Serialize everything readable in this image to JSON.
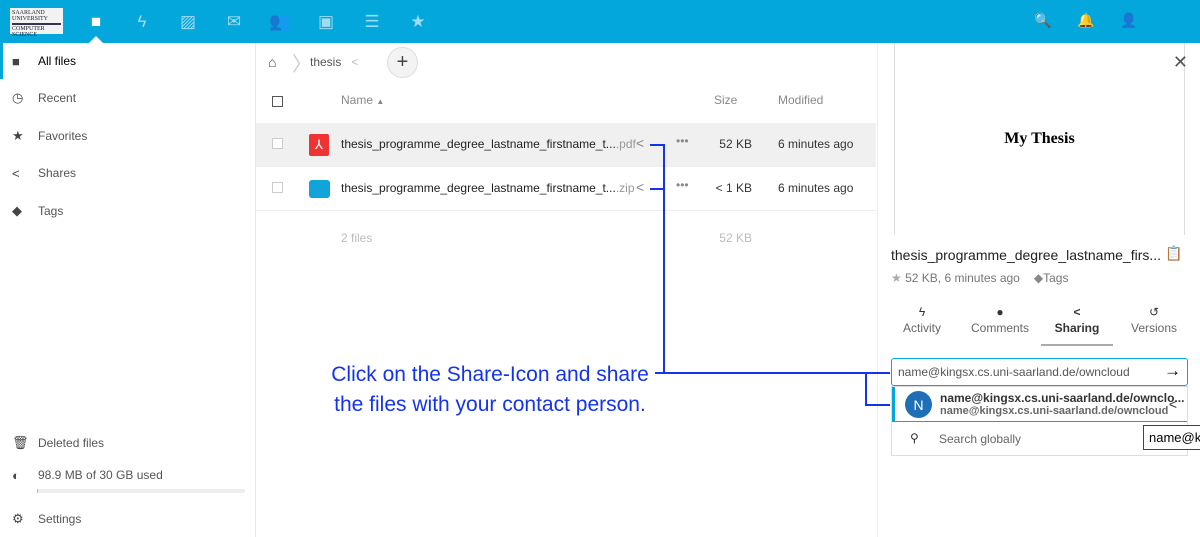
{
  "header": {
    "logo": {
      "line1": "SAARLAND",
      "line2": "UNIVERSITY",
      "line3": "COMPUTER SCIENCE"
    },
    "apps": [
      {
        "icon": "folder-icon",
        "name": "files"
      },
      {
        "icon": "lightning-icon",
        "name": "activity"
      },
      {
        "icon": "image-icon",
        "name": "gallery"
      },
      {
        "icon": "mail-icon",
        "name": "mail"
      },
      {
        "icon": "contacts-icon",
        "name": "contacts"
      },
      {
        "icon": "calendar-icon",
        "name": "calendar"
      },
      {
        "icon": "deck-icon",
        "name": "deck"
      },
      {
        "icon": "star-icon",
        "name": "favorites"
      }
    ],
    "right_icons": [
      "search-icon",
      "bell-icon",
      "user-icon"
    ],
    "accent": "#03a7dc"
  },
  "sidebar": {
    "items": [
      {
        "label": "All files",
        "icon": "folder-icon"
      },
      {
        "label": "Recent",
        "icon": "clock-icon"
      },
      {
        "label": "Favorites",
        "icon": "star-icon"
      },
      {
        "label": "Shares",
        "icon": "share-icon"
      },
      {
        "label": "Tags",
        "icon": "tag-icon"
      }
    ],
    "deleted": "Deleted files",
    "quota": "98.9 MB of 30 GB used",
    "quota_fraction": 0.003,
    "settings": "Settings"
  },
  "breadcrumb": {
    "folder": "thesis"
  },
  "table": {
    "headers": {
      "name": "Name",
      "size": "Size",
      "modified": "Modified"
    },
    "rows": [
      {
        "name": "thesis_programme_degree_lastname_firstname_t...",
        "ext": ".pdf",
        "size": "52 KB",
        "modified": "6 minutes ago",
        "type": "pdf"
      },
      {
        "name": "thesis_programme_degree_lastname_firstname_t...",
        "ext": ".zip",
        "size": "< 1 KB",
        "modified": "6 minutes ago",
        "type": "zip"
      }
    ],
    "summary": {
      "count": "2 files",
      "size": "52 KB"
    }
  },
  "details": {
    "preview_title": "My Thesis",
    "filename": "thesis_programme_degree_lastname_firs...",
    "meta": "52 KB, 6 minutes ago",
    "tags": "Tags",
    "tabs": [
      {
        "label": "Activity"
      },
      {
        "label": "Comments"
      },
      {
        "label": "Sharing"
      },
      {
        "label": "Versions"
      }
    ],
    "share_input": "name@kingsx.cs.uni-saarland.de/owncloud",
    "suggestion": {
      "initial": "N",
      "title": "name@kingsx.cs.uni-saarland.de/ownclo...",
      "subtitle": "name@kingsx.cs.uni-saarland.de/owncloud"
    },
    "search_globally": "Search globally",
    "tooltip": "name@kingsx.cs.uni-saarland.de/owncloud"
  },
  "annotation": {
    "line1": "Click on the Share-Icon and share",
    "line2": "the files with your contact person.",
    "color": "#1433ee"
  }
}
